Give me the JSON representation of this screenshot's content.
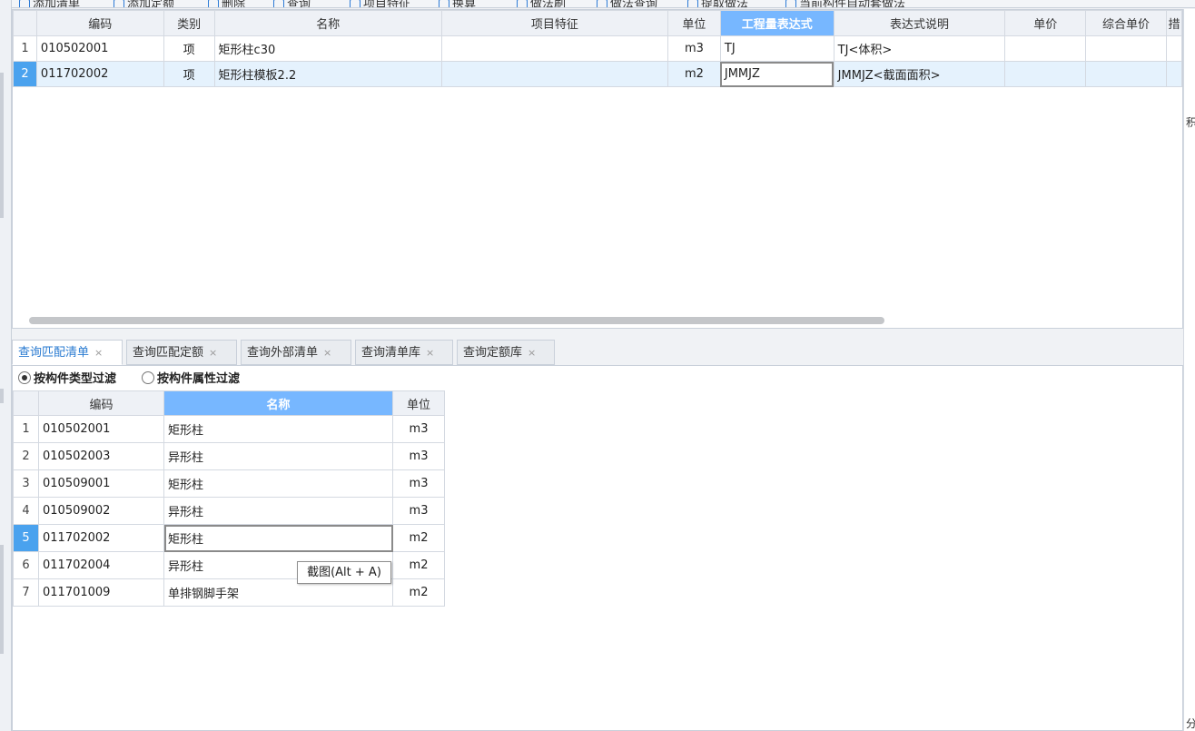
{
  "toolbar": {
    "items": [
      "添加清单",
      "添加定额",
      "删除",
      "查询",
      "项目特征",
      "换算",
      "做法刷",
      "做法查询",
      "提取做法",
      "当前构件自动套做法"
    ]
  },
  "upper_grid": {
    "columns": [
      "编码",
      "类别",
      "名称",
      "项目特征",
      "单位",
      "工程量表达式",
      "表达式说明",
      "单价",
      "综合单价",
      "措"
    ],
    "active_column": "工程量表达式",
    "rows": [
      {
        "no": "1",
        "code": "010502001",
        "type": "项",
        "name": "矩形柱c30",
        "feature": "",
        "unit": "m3",
        "expr": "TJ",
        "desc": "TJ<体积>",
        "price": "",
        "total": ""
      },
      {
        "no": "2",
        "code": "011702002",
        "type": "项",
        "name": "矩形柱模板2.2",
        "feature": "",
        "unit": "m2",
        "expr": "JMMJZ",
        "desc": "JMMJZ<截面面积>",
        "price": "",
        "total": ""
      }
    ]
  },
  "right_edge": {
    "glyph_top": "积",
    "glyph_bottom": "分"
  },
  "tabs": [
    {
      "label": "查询匹配清单",
      "active": true
    },
    {
      "label": "查询匹配定额",
      "active": false
    },
    {
      "label": "查询外部清单",
      "active": false
    },
    {
      "label": "查询清单库",
      "active": false
    },
    {
      "label": "查询定额库",
      "active": false
    }
  ],
  "tab_close": "×",
  "filter": {
    "option1": "按构件类型过滤",
    "option2": "按构件属性过滤",
    "selected": "option1"
  },
  "lower_grid": {
    "columns": [
      "编码",
      "名称",
      "单位"
    ],
    "active_column": "名称",
    "rows": [
      {
        "no": "1",
        "code": "010502001",
        "name": "矩形柱",
        "unit": "m3"
      },
      {
        "no": "2",
        "code": "010502003",
        "name": "异形柱",
        "unit": "m3"
      },
      {
        "no": "3",
        "code": "010509001",
        "name": "矩形柱",
        "unit": "m3"
      },
      {
        "no": "4",
        "code": "010509002",
        "name": "异形柱",
        "unit": "m3"
      },
      {
        "no": "5",
        "code": "011702002",
        "name": "矩形柱",
        "unit": "m2"
      },
      {
        "no": "6",
        "code": "011702004",
        "name": "异形柱",
        "unit": "m2"
      },
      {
        "no": "7",
        "code": "011701009",
        "name": "单排钢脚手架",
        "unit": "m2"
      }
    ],
    "selected_row": "5"
  },
  "tooltip": {
    "text": "截图(Alt + A)"
  }
}
